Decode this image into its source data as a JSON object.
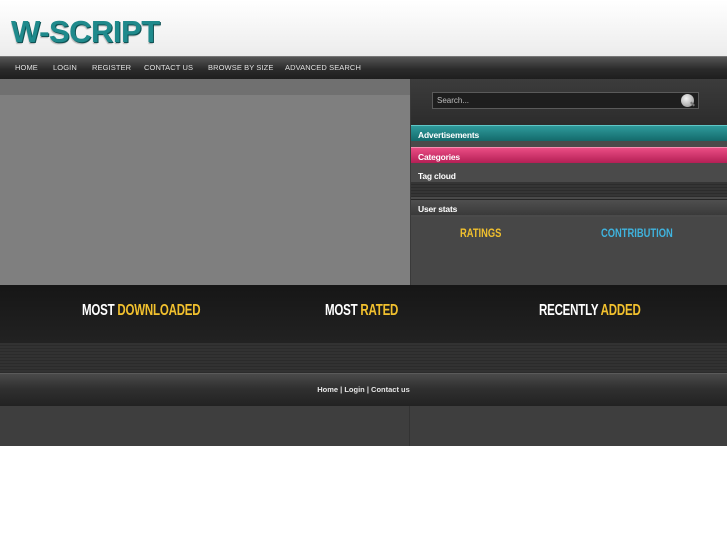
{
  "header": {
    "logo_text": "W-SCRIPT"
  },
  "nav": {
    "items": [
      {
        "label": "HOME"
      },
      {
        "label": "LOGIN"
      },
      {
        "label": "REGISTER"
      },
      {
        "label": "CONTACT US"
      },
      {
        "label": "BROWSE BY SIZE"
      },
      {
        "label": "ADVANCED SEARCH"
      }
    ]
  },
  "sidebar": {
    "search": {
      "placeholder": "Search..."
    },
    "advertisements_label": "Advertisements",
    "categories_label": "Categories",
    "tag_cloud_label": "Tag cloud",
    "user_stats_label": "User stats",
    "ratings_label": "RATINGS",
    "contribution_label": "CONTRIBUTION"
  },
  "sections": {
    "most_downloaded": {
      "first": "MOST",
      "second": "DOWNLOADED"
    },
    "most_rated": {
      "first": "MOST",
      "second": "RATED"
    },
    "recently_added": {
      "first": "RECENTLY",
      "second": "ADDED"
    }
  },
  "footer": {
    "links": [
      {
        "label": "Home"
      },
      {
        "label": "Login"
      },
      {
        "label": "Contact us"
      }
    ],
    "separator": " | "
  },
  "colors": {
    "brand_teal": "#1f8a8c",
    "accent_yellow": "#f2c12e",
    "accent_blue": "#3fb4df",
    "categories_pink": "#e0447c",
    "ads_teal": "#1f7f80"
  }
}
